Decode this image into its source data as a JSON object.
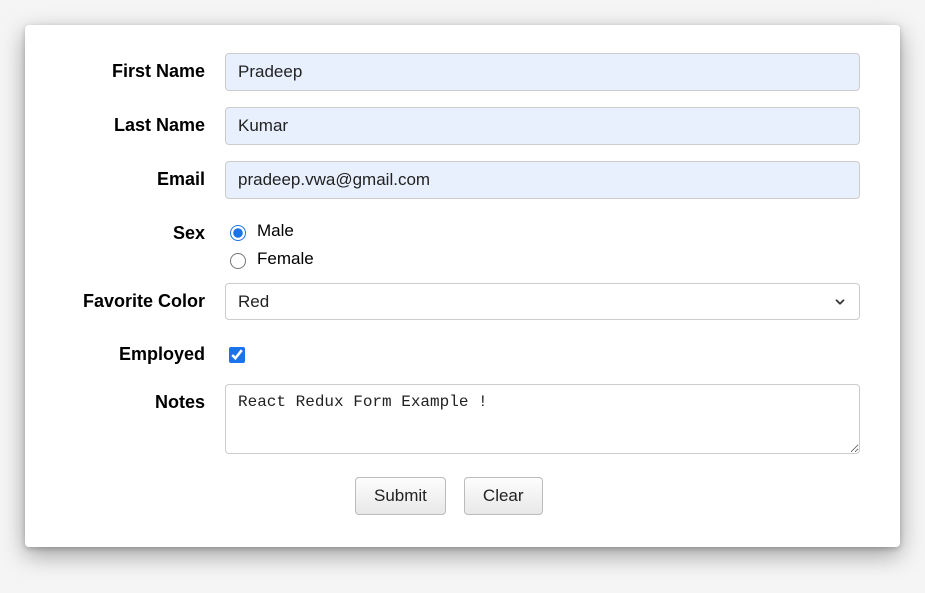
{
  "form": {
    "firstName": {
      "label": "First Name",
      "value": "Pradeep"
    },
    "lastName": {
      "label": "Last Name",
      "value": "Kumar"
    },
    "email": {
      "label": "Email",
      "value": "pradeep.vwa@gmail.com"
    },
    "sex": {
      "label": "Sex",
      "options": {
        "male": {
          "label": "Male",
          "checked": true
        },
        "female": {
          "label": "Female",
          "checked": false
        }
      }
    },
    "favoriteColor": {
      "label": "Favorite Color",
      "selected": "Red"
    },
    "employed": {
      "label": "Employed",
      "checked": true
    },
    "notes": {
      "label": "Notes",
      "value": "React Redux Form Example !"
    }
  },
  "buttons": {
    "submit": "Submit",
    "clear": "Clear"
  }
}
